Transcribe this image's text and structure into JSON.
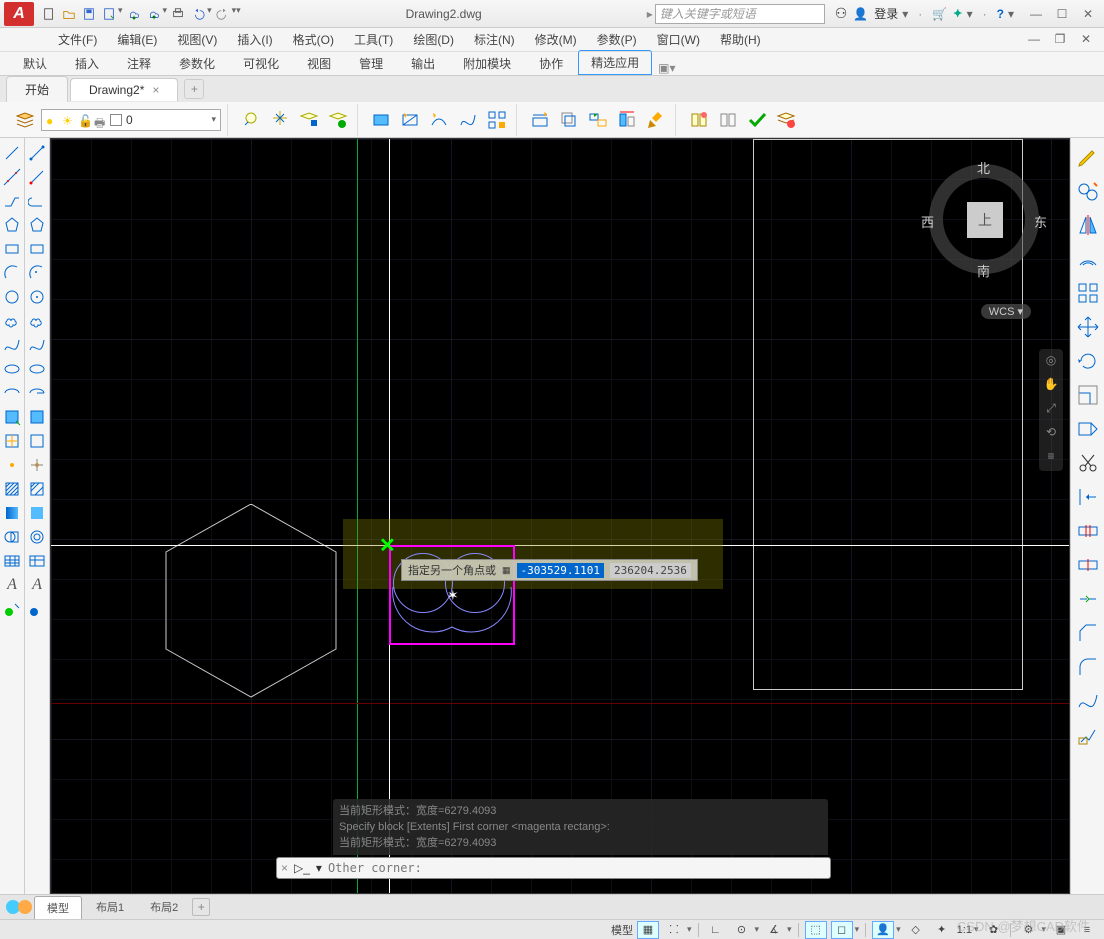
{
  "title": "Drawing2.dwg",
  "search_placeholder": "键入关键字或短语",
  "login_text": "登录",
  "menubar": [
    "文件(F)",
    "编辑(E)",
    "视图(V)",
    "插入(I)",
    "格式(O)",
    "工具(T)",
    "绘图(D)",
    "标注(N)",
    "修改(M)",
    "参数(P)",
    "窗口(W)",
    "帮助(H)"
  ],
  "ribbon_tabs": [
    "默认",
    "插入",
    "注释",
    "参数化",
    "可视化",
    "视图",
    "管理",
    "输出",
    "附加模块",
    "协作",
    "精选应用"
  ],
  "ribbon_active": 10,
  "doc_tabs": [
    {
      "label": "开始",
      "active": false,
      "closable": false
    },
    {
      "label": "Drawing2*",
      "active": true,
      "closable": true
    }
  ],
  "layer_current": "0",
  "viewcube": {
    "n": "北",
    "s": "南",
    "e": "东",
    "w": "西",
    "face": "上",
    "wcs": "WCS"
  },
  "tooltip": {
    "label": "指定另一个角点或",
    "val1": "-303529.1101",
    "val2": "236204.2536"
  },
  "cmd_history": [
    "当前矩形模式：宽度=6279.4093",
    "Specify block [Extents] First corner <magenta rectang>:",
    "当前矩形模式：宽度=6279.4093"
  ],
  "cmd_prompt": "Other corner:",
  "layout_tabs": [
    "模型",
    "布局1",
    "布局2"
  ],
  "layout_active": 0,
  "statusbar": {
    "model": "模型",
    "scale": "1:1",
    "watermark": "CSDN @梦想CAD软件"
  }
}
